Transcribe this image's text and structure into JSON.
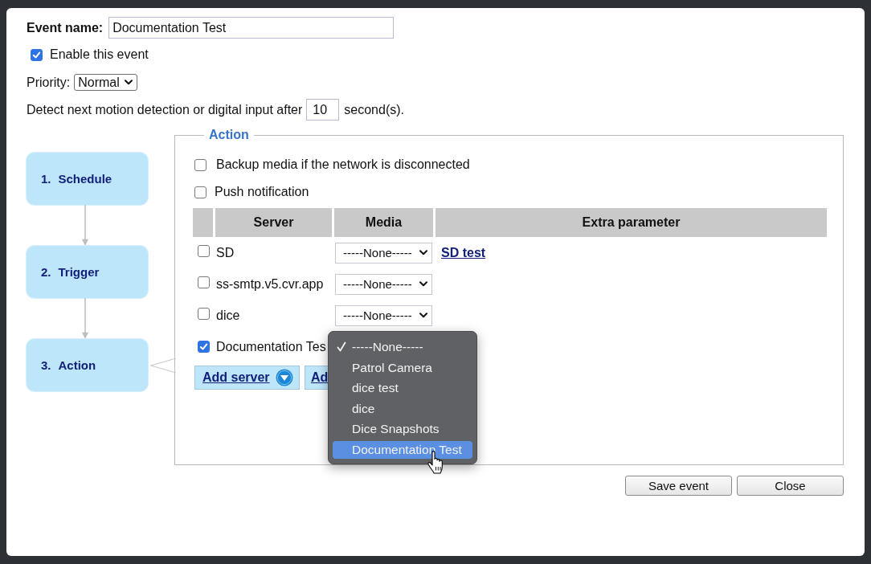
{
  "event_name": {
    "label": "Event name:",
    "value": "Documentation Test"
  },
  "enable_event": {
    "label": "Enable this event",
    "checked": true
  },
  "priority": {
    "label": "Priority:",
    "value": "Normal"
  },
  "detect_interval": {
    "text_before": "Detect next motion detection or digital input after",
    "value": "10",
    "text_after": "second(s)."
  },
  "steps": [
    {
      "number": "1.",
      "label": "Schedule"
    },
    {
      "number": "2.",
      "label": "Trigger"
    },
    {
      "number": "3.",
      "label": "Action"
    }
  ],
  "action_panel": {
    "legend": "Action",
    "options": [
      {
        "label": "Backup media if the network is disconnected",
        "checked": false
      },
      {
        "label": "Push notification",
        "checked": false
      }
    ],
    "server_table": {
      "columns": [
        "Server",
        "Media",
        "Extra parameter"
      ],
      "rows": [
        {
          "checked": false,
          "server": "SD",
          "media": "-----None-----",
          "extra_link": "SD test"
        },
        {
          "checked": false,
          "server": "ss-smtp.v5.cvr.app",
          "media": "-----None-----"
        },
        {
          "checked": false,
          "server": "dice",
          "media": "-----None-----"
        },
        {
          "checked": true,
          "server": "Documentation Tes",
          "media_menu": {
            "options": [
              {
                "label": "-----None-----",
                "selected": true,
                "highlighted": false
              },
              {
                "label": "Patrol Camera",
                "selected": false,
                "highlighted": false
              },
              {
                "label": "dice test",
                "selected": false,
                "highlighted": false
              },
              {
                "label": "dice",
                "selected": false,
                "highlighted": false
              },
              {
                "label": "Dice Snapshots",
                "selected": false,
                "highlighted": false
              },
              {
                "label": "Documentation Test",
                "selected": false,
                "highlighted": true
              }
            ]
          }
        }
      ]
    },
    "buttons": [
      {
        "label": "Add server",
        "dropdown": true
      },
      {
        "label": "Ad"
      }
    ]
  },
  "footer_buttons": [
    "Save event",
    "Close"
  ]
}
